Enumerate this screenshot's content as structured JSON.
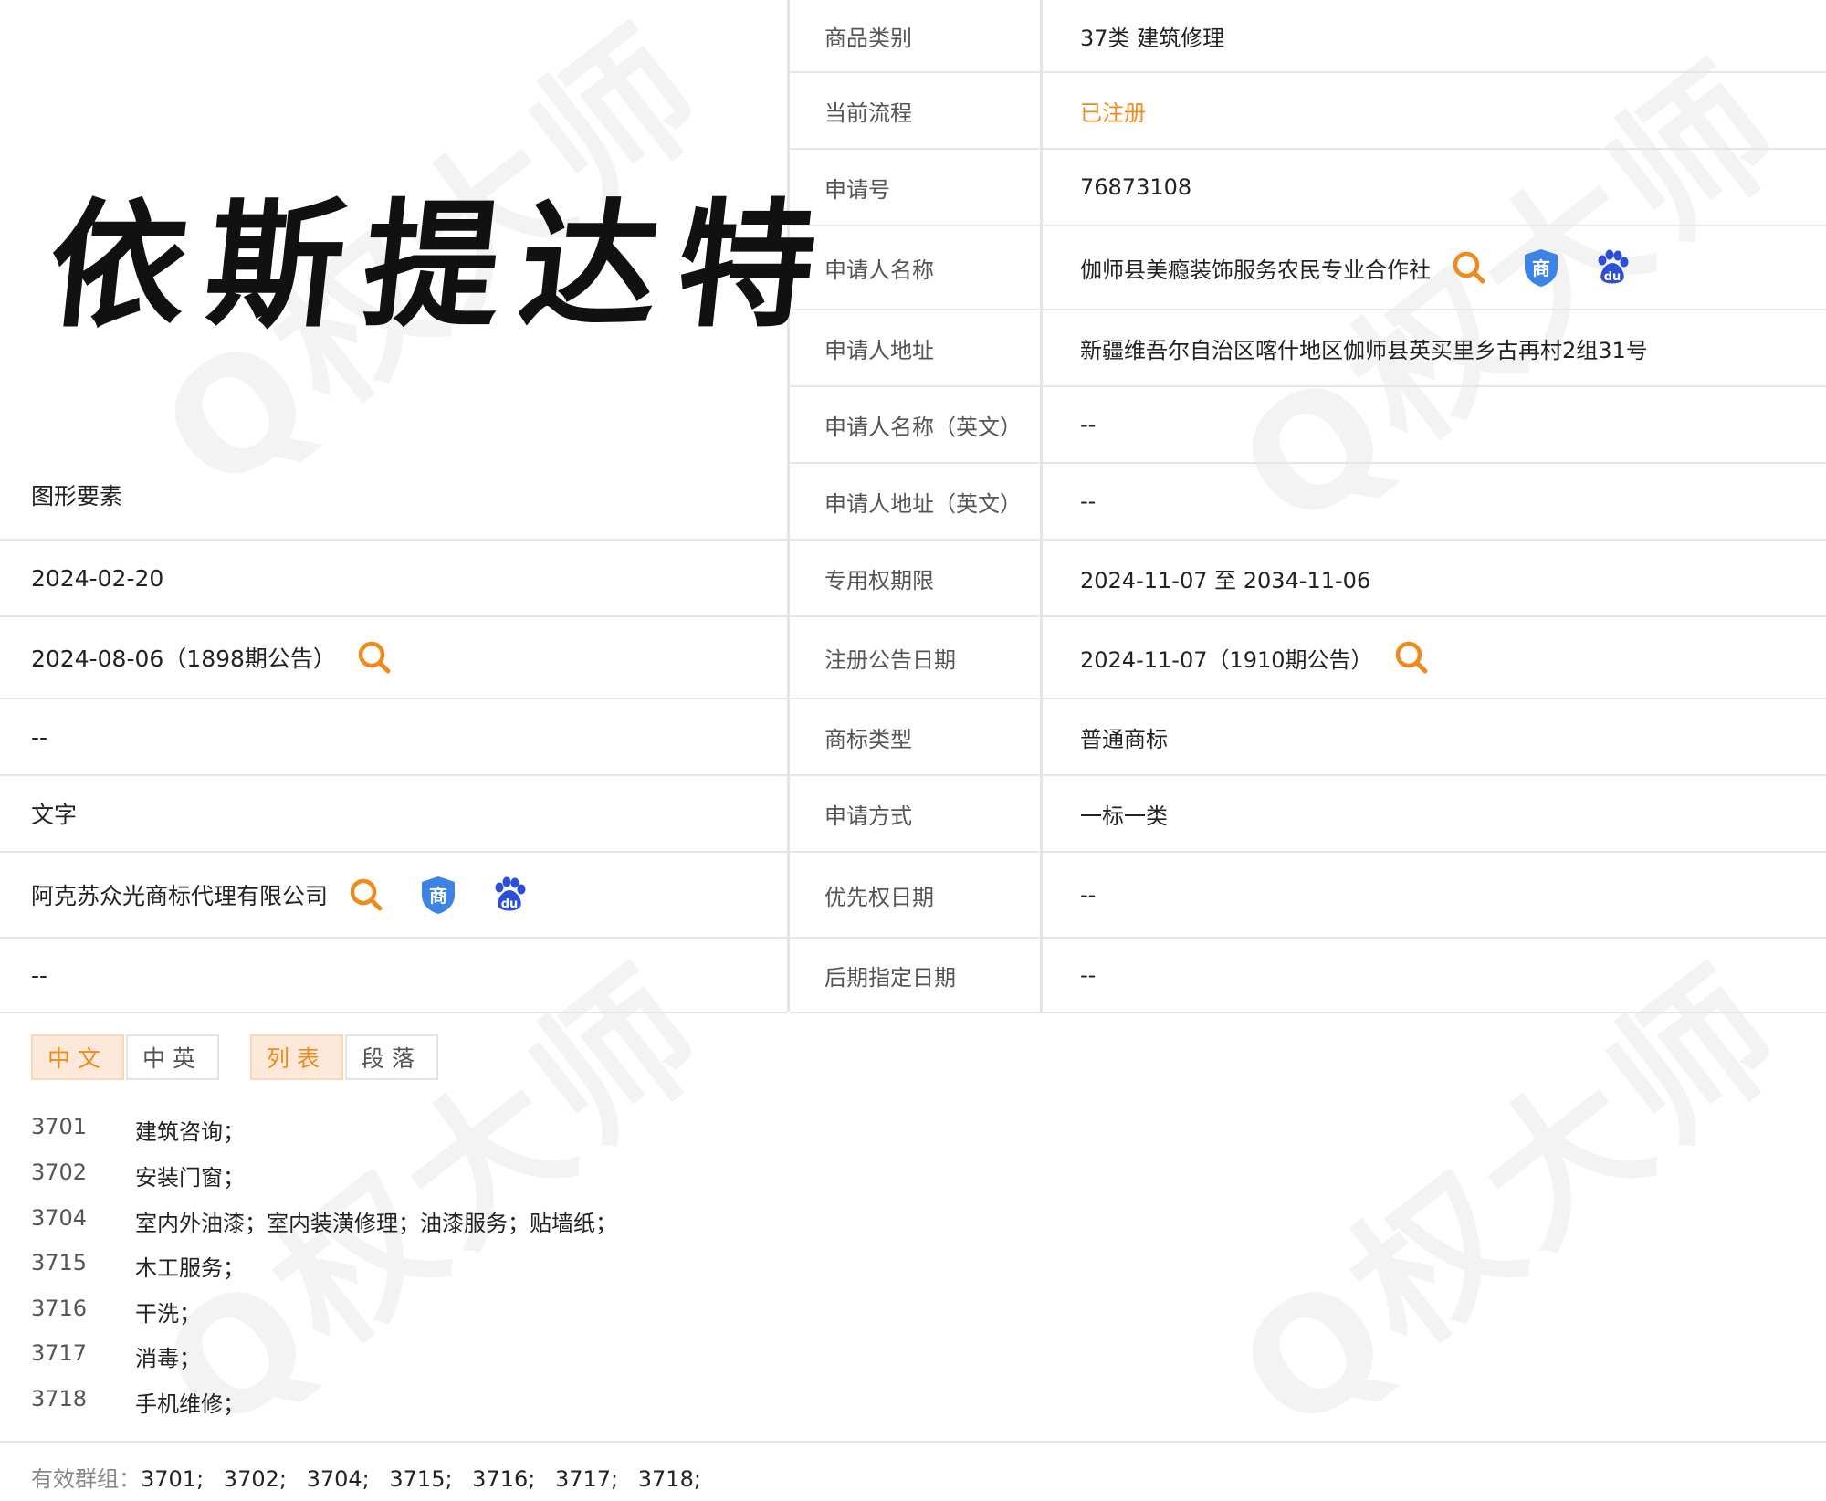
{
  "logo_text": "依斯提达特",
  "left": {
    "figure_label": "图形要素",
    "rows": [
      {
        "value": "2024-02-20"
      },
      {
        "value": "2024-08-06（1898期公告）"
      },
      {
        "value": "--"
      },
      {
        "value": "文字"
      },
      {
        "value": "阿克苏众光商标代理有限公司"
      },
      {
        "value": "--"
      }
    ]
  },
  "right": {
    "rows": [
      {
        "label": "商品类别",
        "value": "37类 建筑修理"
      },
      {
        "label": "当前流程",
        "value": "已注册"
      },
      {
        "label": "申请号",
        "value": "76873108"
      },
      {
        "label": "申请人名称",
        "value": "伽师县美瘾装饰服务农民专业合作社"
      },
      {
        "label": "申请人地址",
        "value": "新疆维吾尔自治区喀什地区伽师县英买里乡古再村2组31号"
      },
      {
        "label": "申请人名称（英文）",
        "value": "--"
      },
      {
        "label": "申请人地址（英文）",
        "value": "--"
      },
      {
        "label": "专用权期限",
        "value": "2024-11-07 至 2034-11-06"
      },
      {
        "label": "注册公告日期",
        "value": "2024-11-07（1910期公告）"
      },
      {
        "label": "商标类型",
        "value": "普通商标"
      },
      {
        "label": "申请方式",
        "value": "一标一类"
      },
      {
        "label": "优先权日期",
        "value": "--"
      },
      {
        "label": "后期指定日期",
        "value": "--"
      }
    ]
  },
  "tabs": {
    "lang": [
      "中文",
      "中英"
    ],
    "view": [
      "列表",
      "段落"
    ]
  },
  "items": [
    {
      "code": "3701",
      "desc": "建筑咨询；"
    },
    {
      "code": "3702",
      "desc": "安装门窗；"
    },
    {
      "code": "3704",
      "desc": "室内外油漆；室内装潢修理；油漆服务；贴墙纸；"
    },
    {
      "code": "3715",
      "desc": "木工服务；"
    },
    {
      "code": "3716",
      "desc": "干洗；"
    },
    {
      "code": "3717",
      "desc": "消毒；"
    },
    {
      "code": "3718",
      "desc": "手机维修；"
    }
  ],
  "groups": {
    "label": "有效群组：",
    "codes": "3701; 3702; 3704; 3715; 3716; 3717; 3718;"
  },
  "colors": {
    "accent": "#f08a1c",
    "shang_blue": "#3d83e6",
    "baidu_blue": "#2b4fd8"
  }
}
